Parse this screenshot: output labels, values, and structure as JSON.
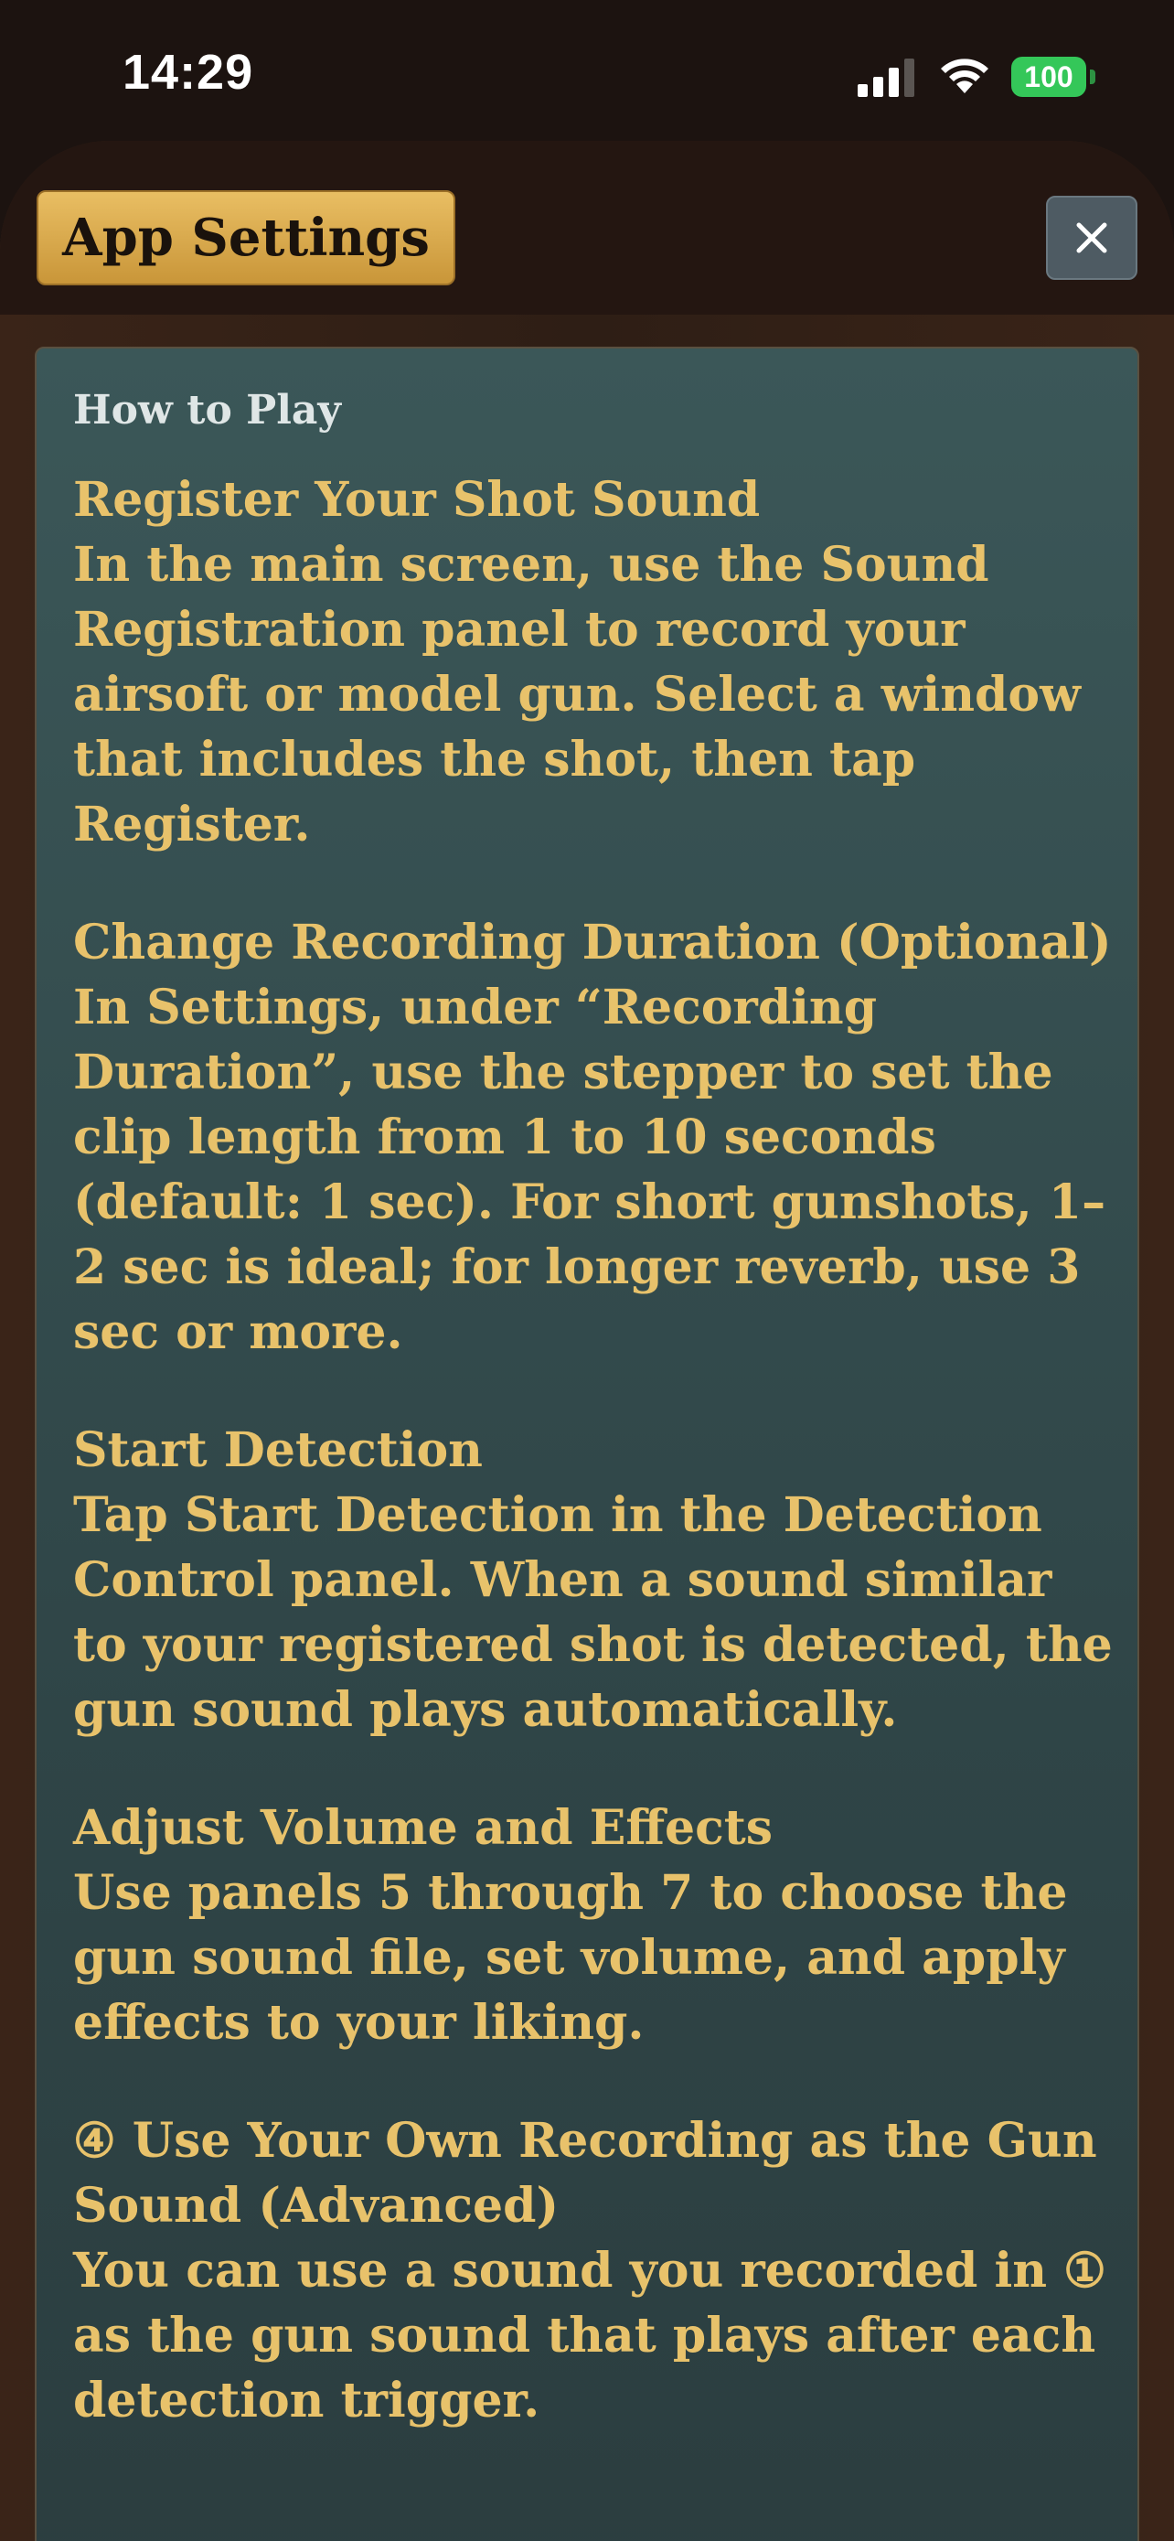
{
  "status_bar": {
    "time": "14:29",
    "battery": "100"
  },
  "header": {
    "title": "App Settings",
    "close_label": "close"
  },
  "card": {
    "title": "How to Play",
    "sections": [
      {
        "heading": "Register Your Shot Sound",
        "body": "In the main screen, use the Sound Registration panel to record your airsoft or model gun. Select a window that includes the shot, then tap Register."
      },
      {
        "heading": "Change Recording Duration (Optional)",
        "body": "In Settings, under “Recording Duration”, use the stepper to set the clip length from 1 to 10 seconds (default: 1 sec). For short gunshots, 1–2 sec is ideal; for longer reverb, use 3 sec or more."
      },
      {
        "heading": "Start Detection",
        "body": "Tap Start Detection in the Detection Control panel. When a sound similar to your registered shot is detected, the gun sound plays automatically."
      },
      {
        "heading": "Adjust Volume and Effects",
        "body": "Use panels 5 through 7 to choose the gun sound file, set volume, and apply effects to your liking."
      },
      {
        "heading": "④ Use Your Own Recording as the Gun Sound (Advanced)",
        "body": "You can use a sound you recorded in ① as the gun sound that plays after each detection trigger."
      }
    ]
  }
}
